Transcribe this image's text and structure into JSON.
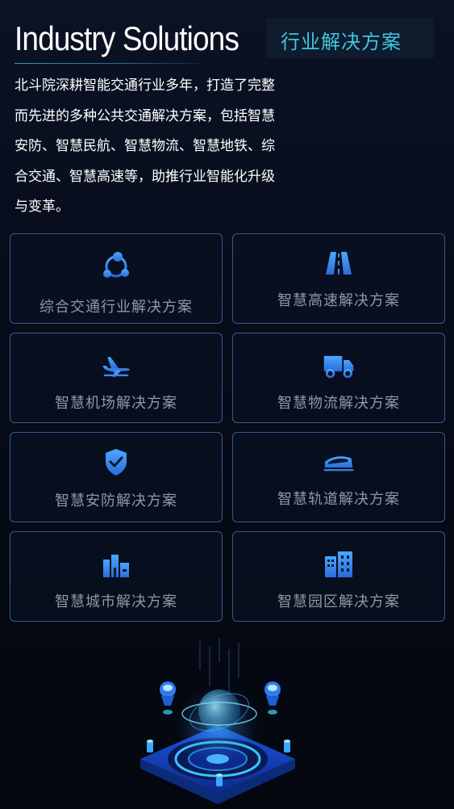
{
  "header": {
    "title_en": "Industry Solutions",
    "title_cn": "行业解决方案"
  },
  "intro": {
    "lines": [
      "北斗院深耕智能交通行业多年，打造了完整",
      "而先进的多种公共交通解决方案，包括智慧",
      "安防、智慧民航、智慧物流、智慧地铁、综",
      "合交通、智慧高速等，助推行业智能化升级",
      "与变革。"
    ]
  },
  "solutions": [
    {
      "label": "综合交通行业解决方案",
      "icon": "network-nodes-icon"
    },
    {
      "label": "智慧高速解决方案",
      "icon": "highway-icon"
    },
    {
      "label": "智慧机场解决方案",
      "icon": "airplane-icon"
    },
    {
      "label": "智慧物流解决方案",
      "icon": "truck-icon"
    },
    {
      "label": "智慧安防解决方案",
      "icon": "shield-check-icon"
    },
    {
      "label": "智慧轨道解决方案",
      "icon": "bullet-train-icon"
    },
    {
      "label": "智慧城市解决方案",
      "icon": "city-buildings-icon"
    },
    {
      "label": "智慧园区解决方案",
      "icon": "office-buildings-icon"
    }
  ],
  "colors": {
    "accent": "#3ec7dc",
    "card_border": "#3a5a8f",
    "icon_blue": "#3a8fe8",
    "label_gray": "#8c98a8"
  }
}
